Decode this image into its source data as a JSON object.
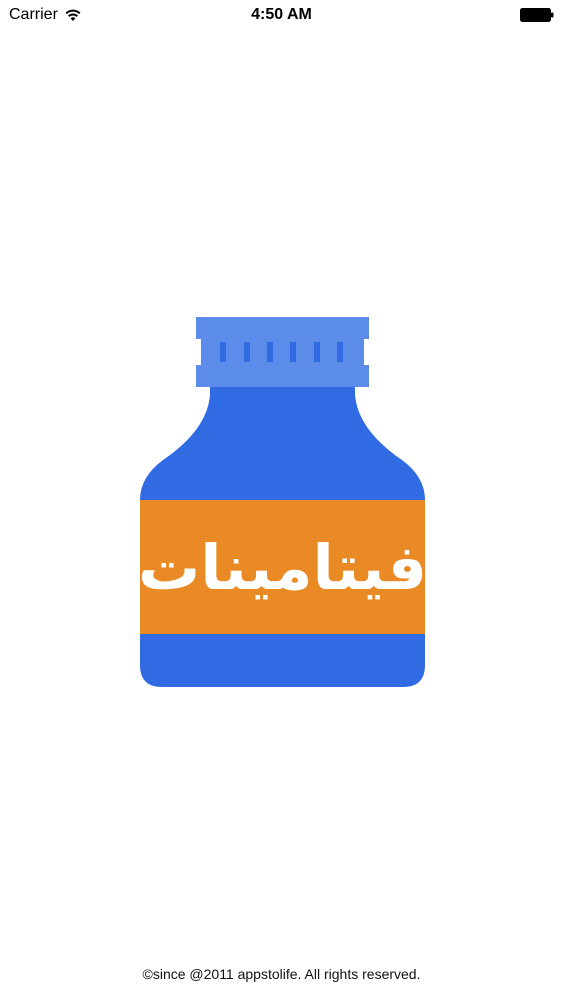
{
  "status_bar": {
    "carrier": "Carrier",
    "time": "4:50 AM",
    "icons": [
      "wifi-icon",
      "battery-icon"
    ]
  },
  "logo": {
    "icon": "vitamin-bottle-icon",
    "label": "فيتامينات",
    "colors": {
      "cap": "#5b8cea",
      "cap_ridges": "#3a6fe0",
      "bottle": "#306be4",
      "label_band": "#ea8a24",
      "text": "#ffffff"
    }
  },
  "footer": {
    "copyright": "©since @2011 appstolife. All rights reserved."
  }
}
